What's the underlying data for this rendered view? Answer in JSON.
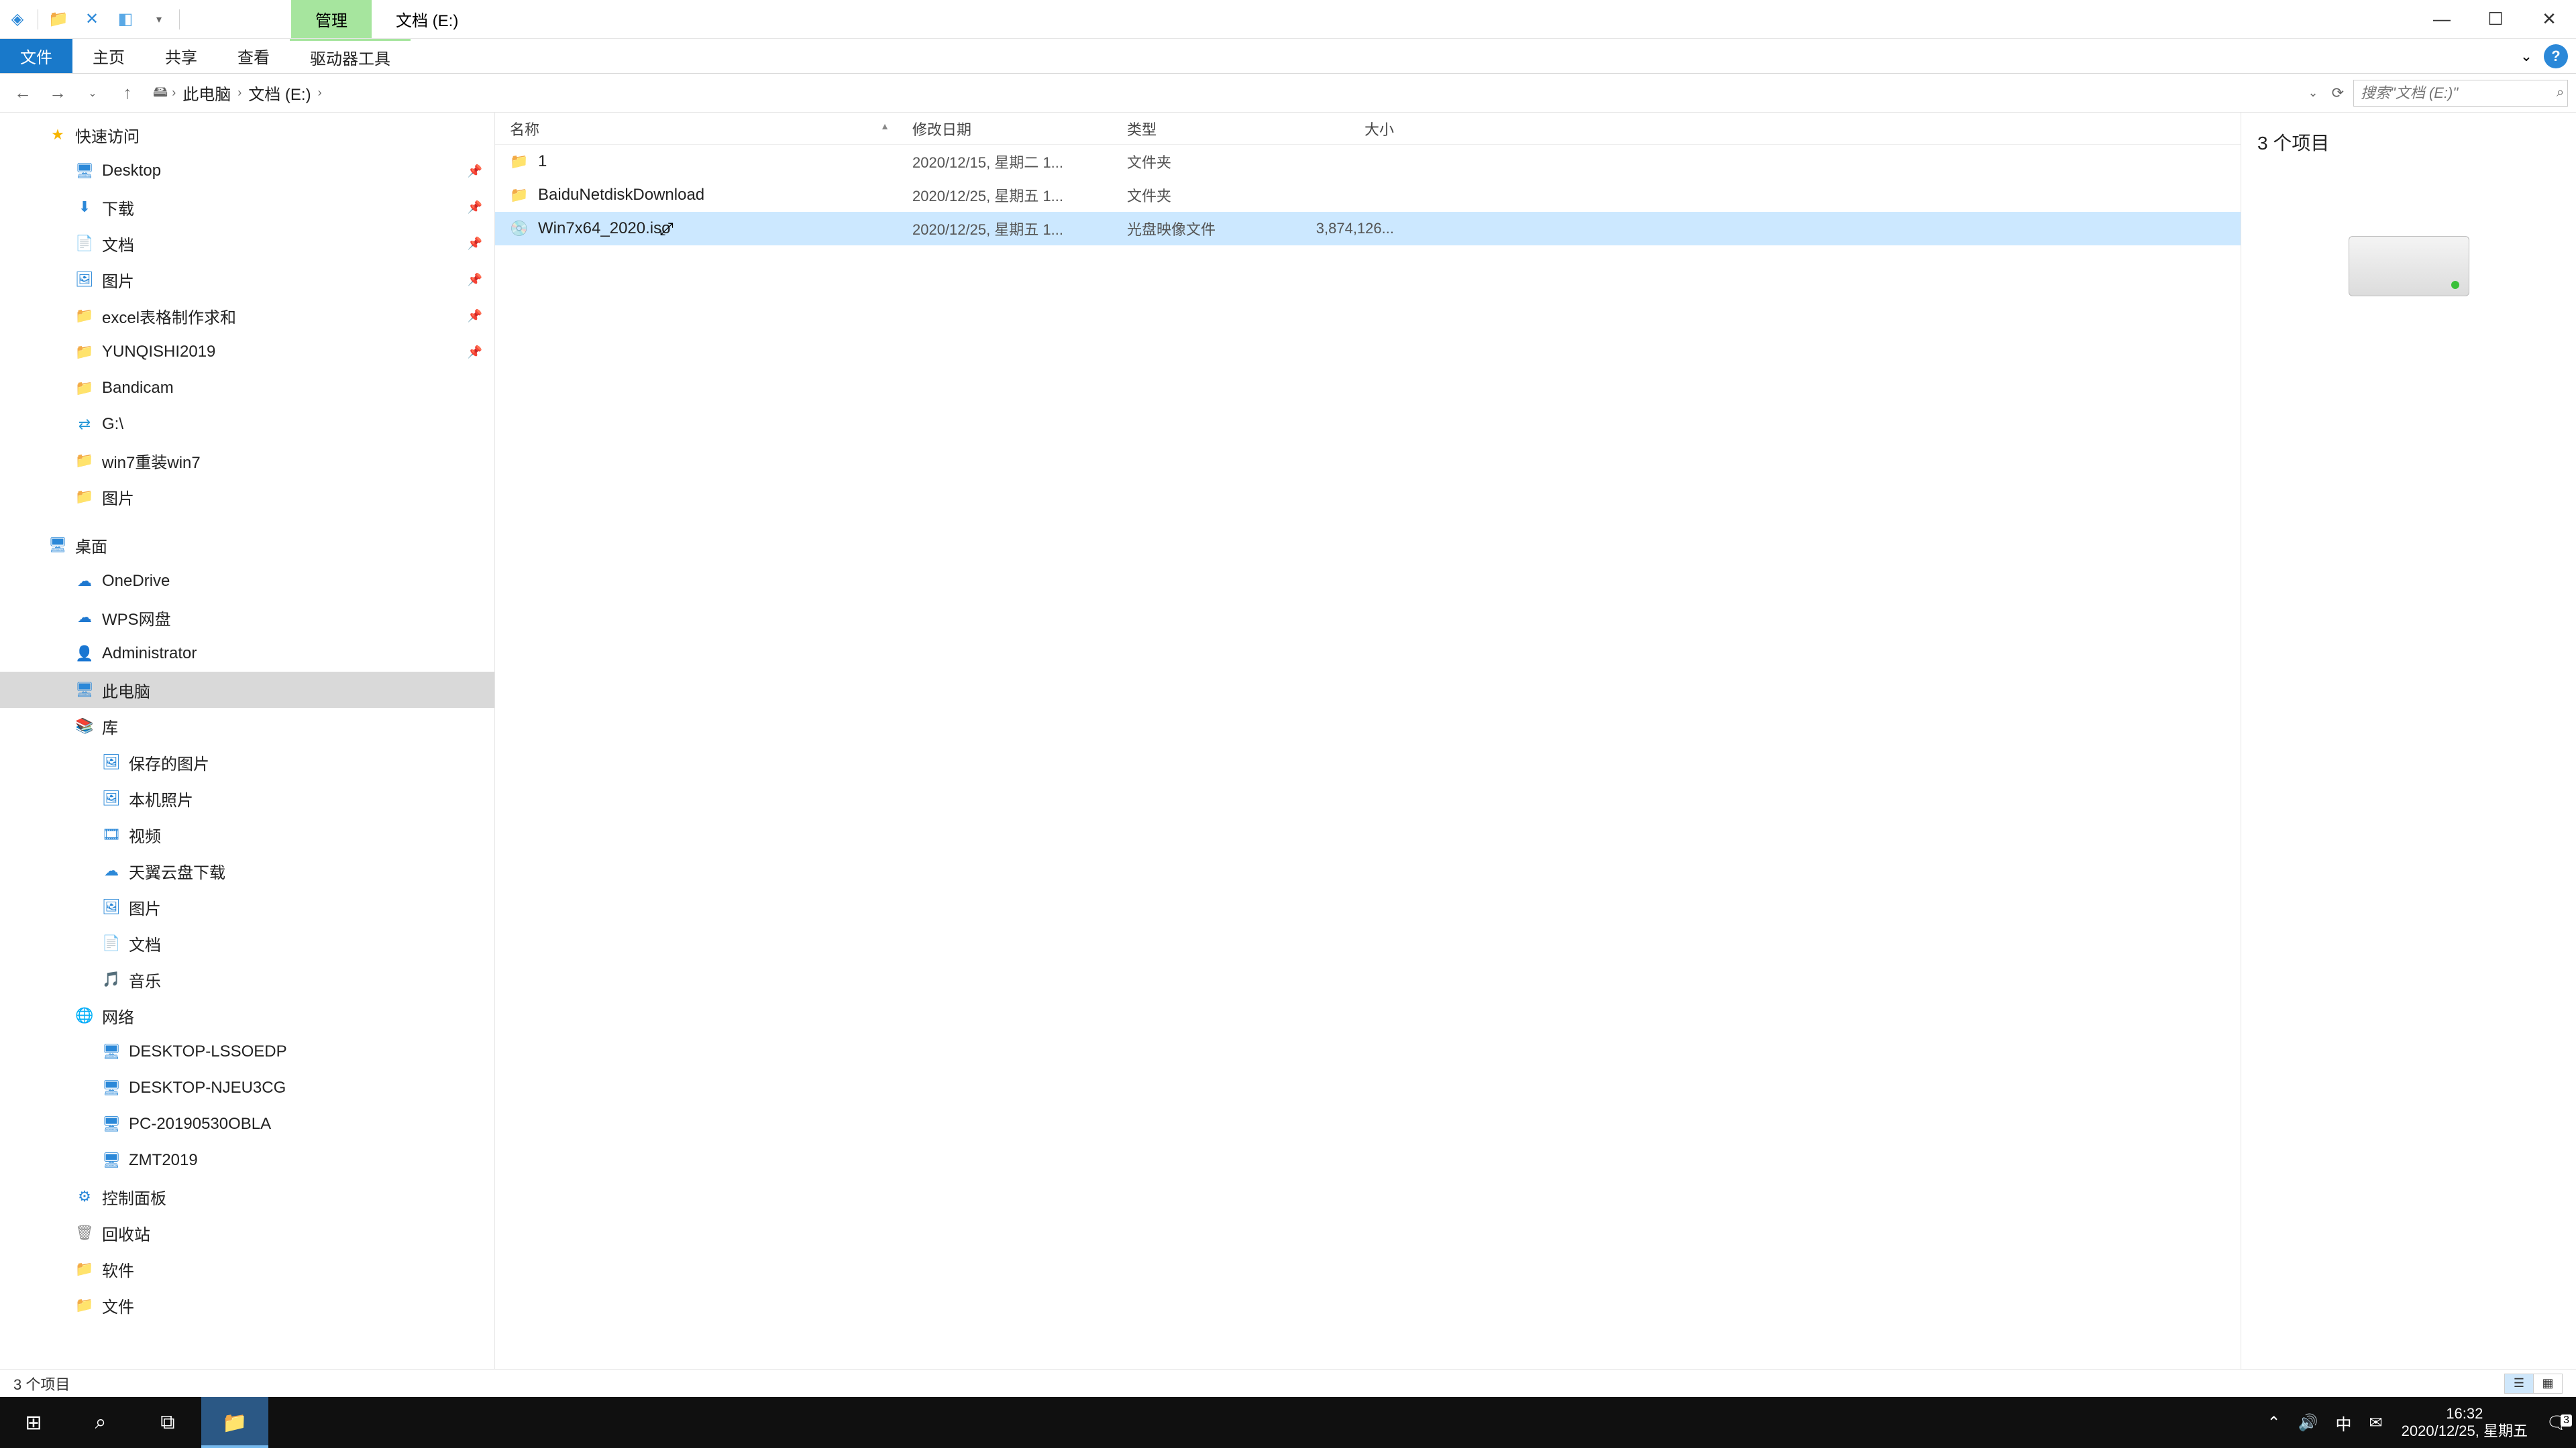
{
  "title": {
    "context_tab": "管理",
    "location_tab": "文档 (E:)"
  },
  "qat": {
    "icon1": "app-icon",
    "icon2": "folder-icon",
    "icon3": "cancel-icon",
    "icon4": "tag-icon",
    "dropdown": "qat-dropdown"
  },
  "window_controls": {
    "min": "—",
    "max": "☐",
    "close": "✕"
  },
  "ribbon": {
    "tabs": [
      "文件",
      "主页",
      "共享",
      "查看",
      "驱动器工具"
    ],
    "active_index": 0,
    "caret": "⌄",
    "help": "?"
  },
  "nav": {
    "back": "←",
    "forward": "→",
    "history": "⌄",
    "up": "↑"
  },
  "breadcrumb": {
    "root_icon": "pc-icon",
    "items": [
      "此电脑",
      "文档 (E:)"
    ]
  },
  "addr_tail": {
    "chevron": "⌄",
    "refresh": "⟳"
  },
  "search": {
    "placeholder": "搜索\"文档 (E:)\"",
    "icon": "⌕"
  },
  "tree": {
    "items": [
      {
        "label": "快速访问",
        "icon": "★",
        "cls": "ic-star",
        "depth": 0,
        "expand": ""
      },
      {
        "label": "Desktop",
        "icon": "🖥",
        "cls": "ic-desktop",
        "depth": 1,
        "pin": true
      },
      {
        "label": "下载",
        "icon": "⬇",
        "cls": "ic-dl",
        "depth": 1,
        "pin": true
      },
      {
        "label": "文档",
        "icon": "📄",
        "cls": "ic-doc",
        "depth": 1,
        "pin": true
      },
      {
        "label": "图片",
        "icon": "🖼",
        "cls": "ic-pic",
        "depth": 1,
        "pin": true
      },
      {
        "label": "excel表格制作求和",
        "icon": "📁",
        "cls": "ic-folder",
        "depth": 1,
        "pin": true
      },
      {
        "label": "YUNQISHI2019",
        "icon": "📁",
        "cls": "ic-folder",
        "depth": 1,
        "pin": true
      },
      {
        "label": "Bandicam",
        "icon": "📁",
        "cls": "ic-folder",
        "depth": 1
      },
      {
        "label": "G:\\",
        "icon": "⇄",
        "cls": "ic-net",
        "depth": 1
      },
      {
        "label": "win7重装win7",
        "icon": "📁",
        "cls": "ic-folder",
        "depth": 1
      },
      {
        "label": "图片",
        "icon": "📁",
        "cls": "ic-folder",
        "depth": 1
      },
      {
        "label": "桌面",
        "icon": "🖥",
        "cls": "ic-desktop",
        "depth": 0,
        "gap": true
      },
      {
        "label": "OneDrive",
        "icon": "☁",
        "cls": "ic-onedrive",
        "depth": 1
      },
      {
        "label": "WPS网盘",
        "icon": "☁",
        "cls": "ic-wps",
        "depth": 1
      },
      {
        "label": "Administrator",
        "icon": "👤",
        "cls": "ic-user",
        "depth": 1
      },
      {
        "label": "此电脑",
        "icon": "🖥",
        "cls": "ic-pc",
        "depth": 1,
        "selected": true
      },
      {
        "label": "库",
        "icon": "📚",
        "cls": "ic-lib",
        "depth": 1
      },
      {
        "label": "保存的图片",
        "icon": "🖼",
        "cls": "ic-pic",
        "depth": 2
      },
      {
        "label": "本机照片",
        "icon": "🖼",
        "cls": "ic-pic",
        "depth": 2
      },
      {
        "label": "视频",
        "icon": "🎞",
        "cls": "ic-pic",
        "depth": 2
      },
      {
        "label": "天翼云盘下载",
        "icon": "☁",
        "cls": "ic-pic",
        "depth": 2
      },
      {
        "label": "图片",
        "icon": "🖼",
        "cls": "ic-pic",
        "depth": 2
      },
      {
        "label": "文档",
        "icon": "📄",
        "cls": "ic-doc",
        "depth": 2
      },
      {
        "label": "音乐",
        "icon": "🎵",
        "cls": "ic-pic",
        "depth": 2
      },
      {
        "label": "网络",
        "icon": "🌐",
        "cls": "ic-net",
        "depth": 1
      },
      {
        "label": "DESKTOP-LSSOEDP",
        "icon": "🖥",
        "cls": "ic-pc",
        "depth": 2
      },
      {
        "label": "DESKTOP-NJEU3CG",
        "icon": "🖥",
        "cls": "ic-pc",
        "depth": 2
      },
      {
        "label": "PC-20190530OBLA",
        "icon": "🖥",
        "cls": "ic-pc",
        "depth": 2
      },
      {
        "label": "ZMT2019",
        "icon": "🖥",
        "cls": "ic-pc",
        "depth": 2
      },
      {
        "label": "控制面板",
        "icon": "⚙",
        "cls": "ic-cp",
        "depth": 1
      },
      {
        "label": "回收站",
        "icon": "🗑",
        "cls": "ic-bin",
        "depth": 1
      },
      {
        "label": "软件",
        "icon": "📁",
        "cls": "ic-folder",
        "depth": 1
      },
      {
        "label": "文件",
        "icon": "📁",
        "cls": "ic-folder",
        "depth": 1
      }
    ]
  },
  "columns": {
    "name": "名称",
    "date": "修改日期",
    "type": "类型",
    "size": "大小",
    "sort_indicator": "▲"
  },
  "files": [
    {
      "name": "1",
      "icon": "📁",
      "cls": "ic-folder",
      "date": "2020/12/15, 星期二 1...",
      "type": "文件夹",
      "size": "",
      "selected": false
    },
    {
      "name": "BaiduNetdiskDownload",
      "icon": "📁",
      "cls": "ic-folder",
      "date": "2020/12/25, 星期五 1...",
      "type": "文件夹",
      "size": "",
      "selected": false
    },
    {
      "name": "Win7x64_2020.iso",
      "icon": "💿",
      "cls": "ic-file",
      "date": "2020/12/25, 星期五 1...",
      "type": "光盘映像文件",
      "size": "3,874,126...",
      "selected": true
    }
  ],
  "details": {
    "heading": "3 个项目"
  },
  "status": {
    "text": "3 个项目"
  },
  "taskbar": {
    "start": "⊞",
    "search": "⌕",
    "taskview": "⧉",
    "explorer": "📁",
    "tray": {
      "up": "⌃",
      "vol": "🔊",
      "ime": "中",
      "mail": "✉"
    },
    "clock": {
      "time": "16:32",
      "date": "2020/12/25, 星期五"
    },
    "notif": {
      "icon": "🗨",
      "count": "3"
    }
  }
}
